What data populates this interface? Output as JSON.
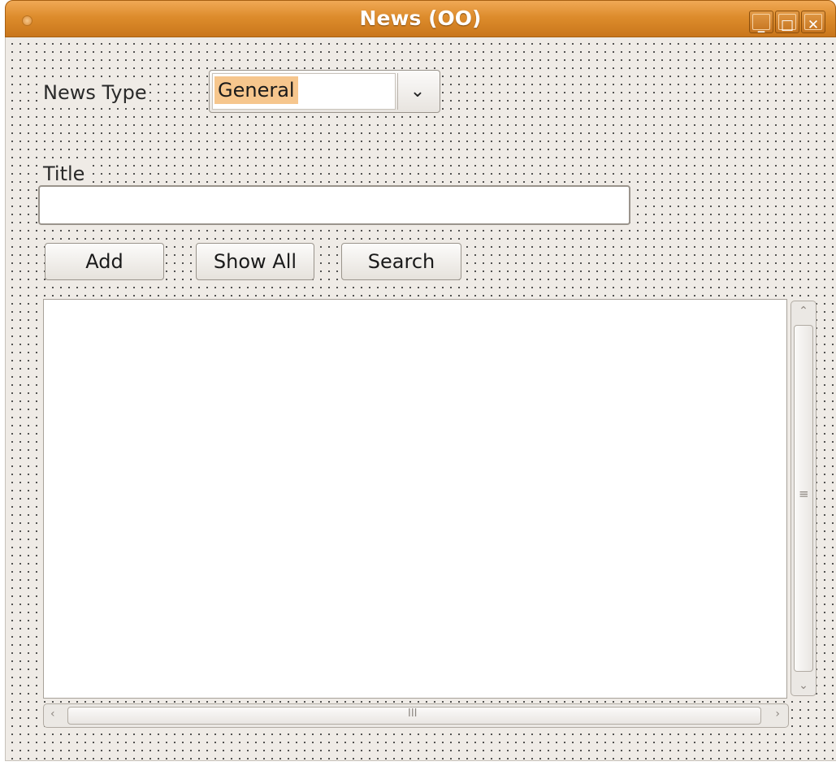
{
  "window": {
    "title": "News (OO)",
    "minimize_glyph": "_",
    "maximize_glyph": "□",
    "close_glyph": "✕"
  },
  "form": {
    "news_type_label": "News Type",
    "news_type_value": "General",
    "title_label": "Title",
    "title_value": ""
  },
  "buttons": {
    "add": "Add",
    "show_all": "Show All",
    "search": "Search"
  },
  "scrollbars": {
    "up_arrow": "⌃",
    "down_arrow": "⌄",
    "left_arrow": "‹",
    "right_arrow": "›",
    "v_grip": "≡",
    "h_grip": "III"
  },
  "colors": {
    "titlebar": "#dd8c2c",
    "selection": "#f6c68d",
    "background": "#efebe6"
  }
}
